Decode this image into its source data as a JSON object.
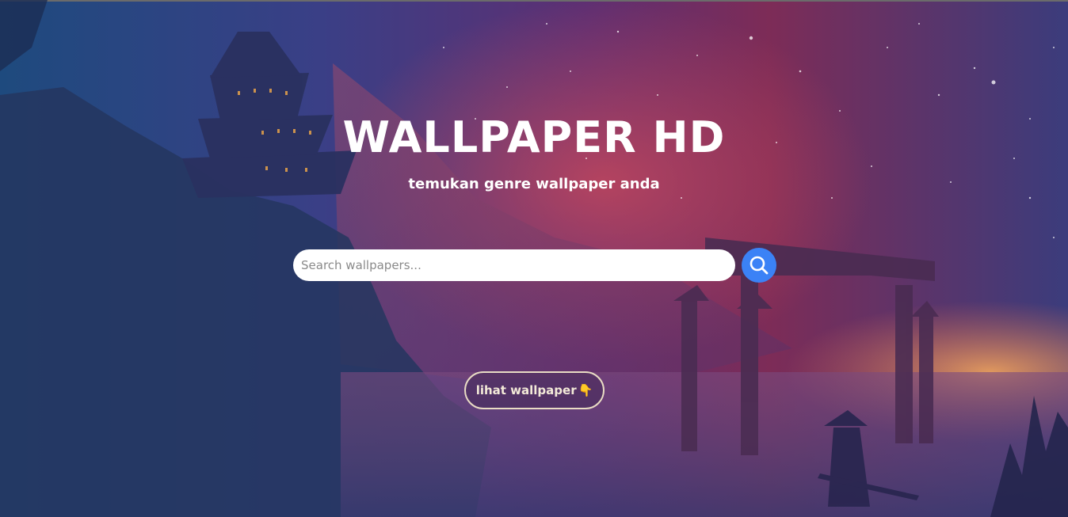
{
  "hero": {
    "title": "WALLPAPER HD",
    "subtitle": "temukan genre wallpaper anda"
  },
  "search": {
    "placeholder": "Search wallpapers...",
    "value": "",
    "button_icon": "search-icon"
  },
  "cta": {
    "label": "lihat wallpaper",
    "icon": "pointing-down-hand-icon"
  },
  "colors": {
    "search_button": "#3b82f6",
    "cta_border": "#e9dcc4",
    "text": "#ffffff"
  }
}
